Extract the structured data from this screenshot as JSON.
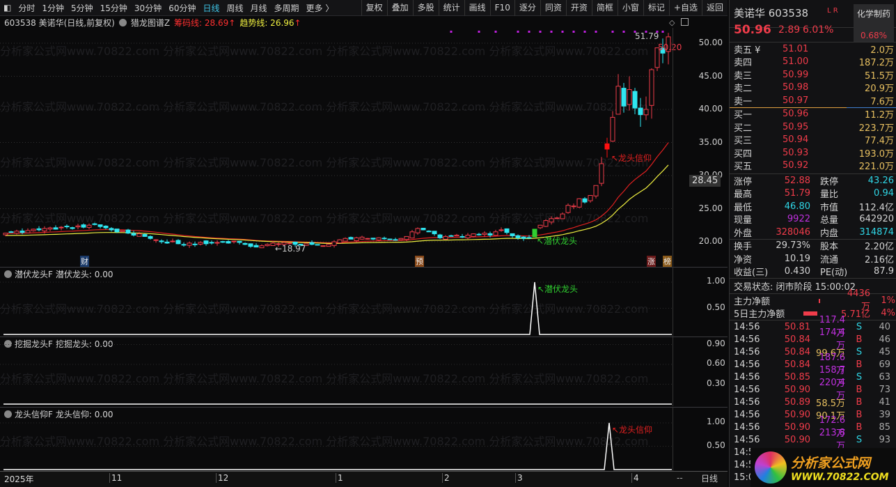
{
  "toolbar": {
    "tabs": [
      "分时",
      "1分钟",
      "5分钟",
      "15分钟",
      "30分钟",
      "60分钟",
      "日线",
      "周线",
      "月线",
      "多周期",
      "更多 〉"
    ],
    "active": "日线",
    "buttons": [
      "复权",
      "叠加",
      "多股",
      "统计",
      "画线",
      "F10",
      "逐分",
      "同资",
      "开资",
      "简框",
      "小窗",
      "标记",
      "+自选",
      "返回"
    ]
  },
  "infobar": {
    "code_name": "603538 美诺华(日线,前复权)",
    "indicator": "猎龙图谱Z",
    "chip_label": "筹码线: 28.69",
    "trend_label": "趋势线: 26.96",
    "arrow": "↑"
  },
  "watermark": "分析家公式网www.70822.com 分析家公式网www.70822.com 分析家公式网www.70822.com 分析家公式网www.70822.com",
  "colors": {
    "up": "#f03c4a",
    "down": "#2fe6f0",
    "chip": "#e02020",
    "trend": "#f0f040",
    "signal_green": "#30d030",
    "signal_red": "#e02020",
    "dots": "#c020e0"
  },
  "chart_data": {
    "type": "candlestick",
    "ylim": [
      17,
      53
    ],
    "y_ticks": [
      "50.00",
      "45.00",
      "40.00",
      "35.00",
      "30.00",
      "25.00",
      "20.00"
    ],
    "y_tick_values": [
      50,
      45,
      40,
      35,
      30,
      25,
      20
    ],
    "current_price_label": "28.45",
    "closes": [
      21.3,
      21.5,
      21.6,
      21.4,
      21.7,
      21.9,
      21.8,
      22.0,
      22.1,
      21.9,
      22.2,
      22.3,
      22.0,
      22.4,
      22.2,
      22.5,
      22.6,
      22.3,
      22.1,
      21.8,
      21.5,
      21.7,
      21.3,
      21.0,
      21.2,
      20.8,
      20.5,
      20.3,
      20.0,
      19.8,
      20.1,
      19.7,
      19.5,
      19.8,
      19.6,
      19.9,
      19.7,
      19.8,
      19.9,
      20.0,
      19.8,
      20.1,
      19.9,
      19.6,
      19.3,
      19.2,
      19.4,
      19.6,
      19.8,
      19.7,
      19.9,
      19.8,
      19.6,
      19.5,
      19.7,
      19.6,
      19.5,
      19.4,
      19.6,
      20.0,
      20.3,
      20.5,
      20.4,
      20.6,
      20.7,
      20.5,
      20.4,
      20.6,
      20.5,
      20.4,
      20.3,
      20.5,
      20.8,
      21.5,
      22.0,
      21.8,
      21.5,
      21.2,
      20.6,
      20.8,
      20.9,
      21.0,
      20.7,
      21.0,
      21.2,
      21.1,
      21.3,
      21.0,
      21.5,
      21.8,
      21.4,
      20.9,
      20.6,
      20.5,
      20.6,
      21.9,
      22.5,
      23.2,
      23.5,
      23.6,
      24.2,
      25.5,
      25.4,
      26.5,
      26.0,
      27.0,
      28.5,
      31.8,
      34.8,
      38.8,
      43.5,
      40.5,
      43.0,
      40.2,
      39.2,
      40.0,
      46.0,
      49.3,
      48.5,
      50.96
    ],
    "x_labels": [
      "2025年",
      "11",
      "12",
      "1",
      "2",
      "3",
      "4"
    ],
    "annotations": {
      "low": "←18.97",
      "high": "51.79",
      "last": "50.20",
      "signal1": "↖潜伏龙头",
      "signal2": "↖龙头信仰"
    },
    "event_markers": [
      "财",
      "预",
      "涨",
      "榜"
    ],
    "dot_indices": [
      80,
      85,
      88,
      92,
      94,
      96,
      98,
      100,
      102,
      104,
      106,
      109,
      111,
      113,
      115,
      117,
      118
    ]
  },
  "panels": [
    {
      "name": "潜伏龙头F",
      "value_label": "潜伏龙头: 0.00",
      "ticks": [
        "1.00",
        "0.50"
      ],
      "signal": "↖潜伏龙头"
    },
    {
      "name": "挖掘龙头F",
      "value_label": "挖掘龙头: 0.00",
      "ticks": [
        "0.90",
        "0.60",
        "0.30"
      ]
    },
    {
      "name": "龙头信仰F",
      "value_label": "龙头信仰: 0.00",
      "ticks": [
        "1.00",
        "0.50"
      ],
      "signal": "↖龙头信仰"
    }
  ],
  "period_label": "日线",
  "scroll_label": "--",
  "quote": {
    "name_code": "美诺华 603538",
    "lr": "L R",
    "sector": "化学制药",
    "sector_pct": "0.68%",
    "price": "50.96",
    "change": "2.89",
    "pct": "6.01%",
    "asks": [
      [
        "卖五 ¥",
        "51.01",
        "2.0万"
      ],
      [
        "卖四",
        "51.00",
        "187.2万"
      ],
      [
        "卖三",
        "50.99",
        "51.5万"
      ],
      [
        "卖二",
        "50.98",
        "20.9万"
      ],
      [
        "卖一",
        "50.97",
        "7.6万"
      ]
    ],
    "bids": [
      [
        "买一",
        "50.96",
        "11.2万"
      ],
      [
        "买二",
        "50.95",
        "223.7万"
      ],
      [
        "买三",
        "50.94",
        "77.4万"
      ],
      [
        "买四",
        "50.93",
        "193.0万"
      ],
      [
        "买五",
        "50.92",
        "221.0万"
      ]
    ],
    "stats1": [
      [
        "涨停",
        "52.88",
        "red",
        "跌停",
        "43.26",
        "cyan"
      ],
      [
        "最高",
        "51.79",
        "red",
        "量比",
        "0.94",
        "cyan"
      ],
      [
        "最低",
        "46.80",
        "cyan",
        "市值",
        "112.4亿",
        "wht"
      ],
      [
        "现量",
        "9922",
        "mag",
        "总量",
        "642920",
        "wht"
      ],
      [
        "外盘",
        "328046",
        "red",
        "内盘",
        "314874",
        "cyan"
      ]
    ],
    "stats2": [
      [
        "换手",
        "29.73%",
        "股本",
        "2.20亿"
      ],
      [
        "净资",
        "10.19",
        "流通",
        "2.16亿"
      ],
      [
        "收益(三)",
        "0.430",
        "PE(动)",
        "87.9"
      ]
    ],
    "status": "交易状态: 闭市阶段 15:00:02",
    "flows": [
      [
        "主力净额",
        "4436万",
        "1%"
      ],
      [
        "5日主力净额",
        "5.71亿",
        "4%"
      ]
    ],
    "ticks": [
      [
        "14:56",
        "50.81",
        "117.4万",
        "S",
        "40",
        "mag"
      ],
      [
        "14:56",
        "50.84",
        "174.4万",
        "B",
        "46",
        "mag"
      ],
      [
        "14:56",
        "50.84",
        "99.6万",
        "S",
        "45",
        "yel"
      ],
      [
        "14:56",
        "50.84",
        "187.6万",
        "B",
        "69",
        "mag"
      ],
      [
        "14:56",
        "50.85",
        "158.7万",
        "S",
        "63",
        "mag"
      ],
      [
        "14:56",
        "50.90",
        "220.4万",
        "B",
        "73",
        "mag"
      ],
      [
        "14:56",
        "50.89",
        "58.5万",
        "B",
        "41",
        "yel"
      ],
      [
        "14:56",
        "50.90",
        "90.1万",
        "B",
        "39",
        "yel"
      ],
      [
        "14:56",
        "50.90",
        "172.6万",
        "B",
        "85",
        "mag"
      ],
      [
        "14:56",
        "50.90",
        "213.8万",
        "S",
        "93",
        "mag"
      ],
      [
        "14:5",
        "",
        "",
        "",
        ""
      ],
      [
        "14:5",
        "",
        "",
        "",
        ""
      ],
      [
        "15:0",
        "",
        "",
        "",
        ""
      ]
    ]
  },
  "logo": {
    "cn": "分析家公式网",
    "url": "WWW.70822.COM"
  }
}
